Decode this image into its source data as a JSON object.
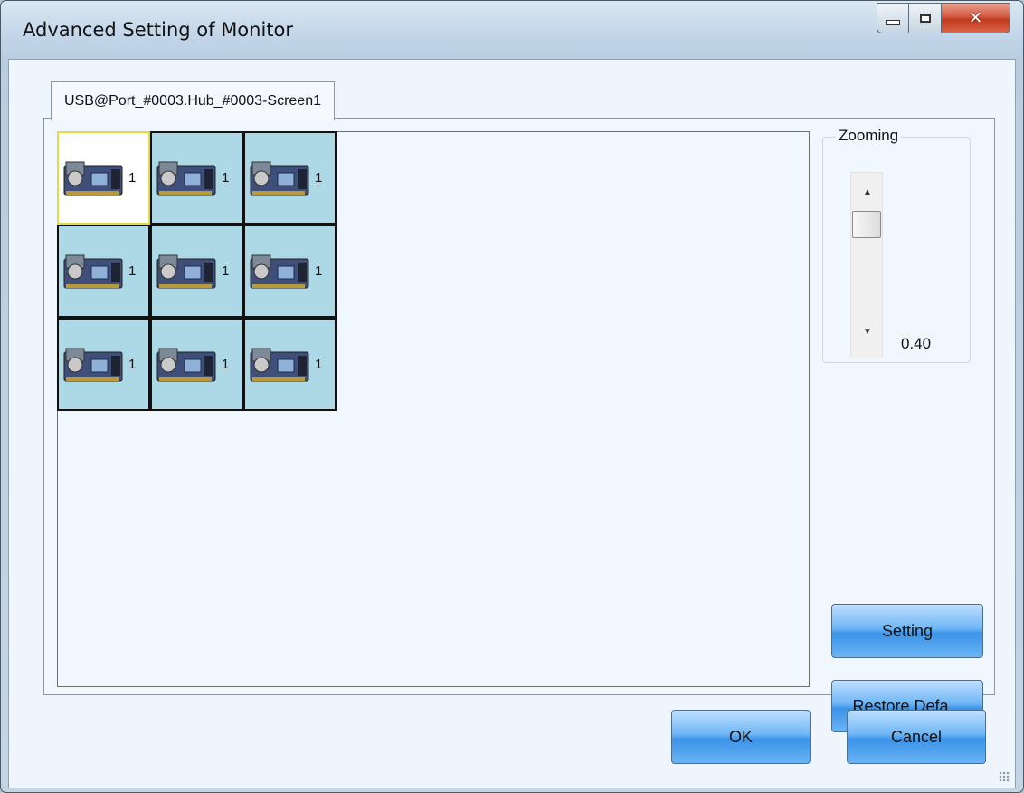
{
  "window": {
    "title": "Advanced Setting of Monitor",
    "controls": {
      "minimize": "minimize-icon",
      "maximize": "maximize-icon",
      "close": "close-icon"
    }
  },
  "tab": {
    "label": "USB@Port_#0003.Hub_#0003-Screen1"
  },
  "grid": {
    "cells": [
      {
        "label": "1",
        "selected": true
      },
      {
        "label": "1",
        "selected": false
      },
      {
        "label": "1",
        "selected": false
      },
      {
        "label": "1",
        "selected": false
      },
      {
        "label": "1",
        "selected": false
      },
      {
        "label": "1",
        "selected": false
      },
      {
        "label": "1",
        "selected": false
      },
      {
        "label": "1",
        "selected": false
      },
      {
        "label": "1",
        "selected": false
      }
    ],
    "icon": "receiving-card-icon",
    "cell_color": "#add8e6",
    "selected_color": "#ffffff"
  },
  "zooming": {
    "label": "Zooming",
    "value": "0.40"
  },
  "buttons": {
    "setting": "Setting",
    "restore": "Restore Defa...",
    "ok": "OK",
    "cancel": "Cancel"
  },
  "colors": {
    "button_accent": "#3b93e8",
    "close_button": "#c0391c"
  }
}
